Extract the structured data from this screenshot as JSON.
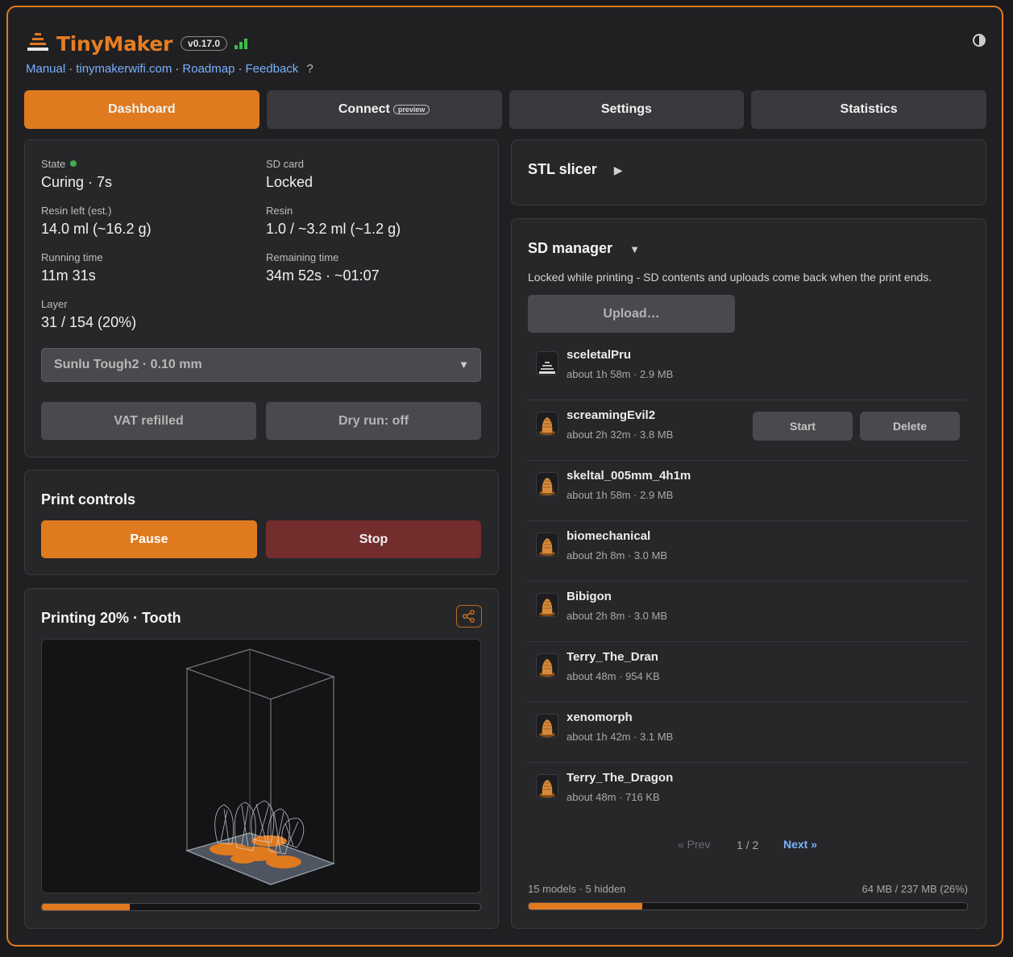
{
  "app": {
    "brand": "TinyMaker",
    "version": "v0.17.0",
    "links": [
      "Manual",
      "tinymakerwifi.com",
      "Roadmap",
      "Feedback"
    ],
    "help": "?",
    "link_separator": "·"
  },
  "tabs": [
    {
      "label": "Dashboard",
      "active": true
    },
    {
      "label": "Connect",
      "badge": "preview"
    },
    {
      "label": "Settings"
    },
    {
      "label": "Statistics"
    }
  ],
  "status": {
    "state_label": "State",
    "state_value": "Curing · 7s",
    "sd_label": "SD card",
    "sd_value": "Locked",
    "resin_left_label": "Resin left (est.)",
    "resin_left_value": "14.0 ml (~16.2 g)",
    "resin_label": "Resin",
    "resin_value": "1.0 / ~3.2 ml (~1.2 g)",
    "running_label": "Running time",
    "running_value": "11m 31s",
    "remaining_label": "Remaining time",
    "remaining_value": "34m 52s · ~01:07",
    "layer_label": "Layer",
    "layer_value": "31 / 154 (20%)",
    "profile": "Sunlu Tough2 · 0.10 mm",
    "vat_button": "VAT refilled",
    "dry_run_button": "Dry run: off"
  },
  "print_controls": {
    "title": "Print controls",
    "pause": "Pause",
    "stop": "Stop"
  },
  "printing": {
    "title": "Printing 20% · Tooth",
    "progress": 0.2
  },
  "stl_slicer": {
    "title": "STL slicer",
    "caret": "▶"
  },
  "sd_manager": {
    "title": "SD manager",
    "caret": "▼",
    "message": "Locked while printing - SD contents and uploads come back when the print ends.",
    "upload": "Upload…",
    "files": [
      {
        "name": "sceletalPru",
        "meta": "about 1h 58m · 2.9 MB"
      },
      {
        "name": "screamingEvil2",
        "meta": "about 2h 32m · 3.8 MB"
      },
      {
        "name": "skeltal_005mm_4h1m",
        "meta": "about 1h 58m · 2.9 MB"
      },
      {
        "name": "biomechanical",
        "meta": "about 2h 8m · 3.0 MB"
      },
      {
        "name": "Bibigon",
        "meta": "about 2h 8m · 3.0 MB"
      },
      {
        "name": "Terry_The_Dran",
        "meta": "about 48m · 954 KB"
      },
      {
        "name": "xenomorph",
        "meta": "about 1h 42m · 3.1 MB"
      },
      {
        "name": "Terry_The_Dragon",
        "meta": "about 48m · 716 KB"
      }
    ],
    "start_label": "Start",
    "delete_label": "Delete",
    "prev": "« Prev",
    "page": "1 / 2",
    "next": "Next »",
    "models_summary": "15 models · 5 hidden",
    "storage": "64 MB / 237 MB (26%)",
    "storage_used": 0.26
  },
  "colors": {
    "accent": "#e07a1f",
    "danger": "#732d2d",
    "link": "#7ab0ff",
    "ok": "#3fae4a"
  }
}
